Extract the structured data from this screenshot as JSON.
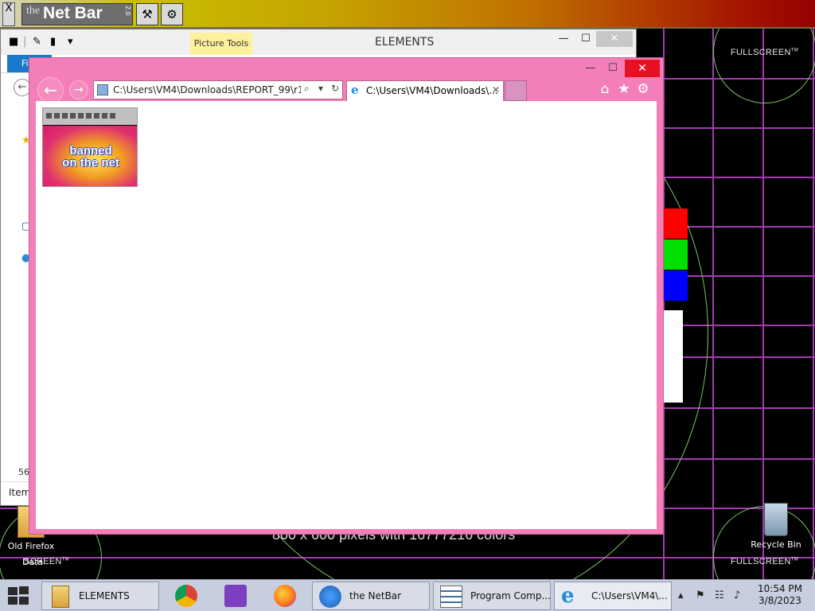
{
  "netbar": {
    "logo_prefix": "the",
    "logo_name": "Net Bar",
    "logo_version": "2.0",
    "close_glyph": "X",
    "buttons": [
      {
        "name": "connect-icon",
        "glyph": "⚒"
      },
      {
        "name": "tools-icon",
        "glyph": "⚙"
      }
    ]
  },
  "explorer": {
    "title": "ELEMENTS",
    "picture_tools": "Picture Tools",
    "file_tab": "Fi",
    "item_count": "56",
    "status_text": "Item",
    "minimize": "—",
    "maximize": "☐",
    "close": "✕"
  },
  "ie": {
    "address": "C:\\Users\\VM4\\Downloads\\REPORT_99\\r1997",
    "tab_title": "C:\\Users\\VM4\\Downloads\\...",
    "tab_close": "✕",
    "minimize": "—",
    "maximize": "☐",
    "close": "✕",
    "back_glyph": "←",
    "forward_glyph": "→",
    "search_glyph": "⌕",
    "dropdown_glyph": "▾",
    "refresh_glyph": "↻",
    "home_glyph": "⌂",
    "favorites_glyph": "★",
    "tools_glyph": "⚙",
    "image_text_line1": "banned",
    "image_text_line2": "on the net"
  },
  "desktop": {
    "fullscreen_labels": [
      "FULLSCREEN",
      "FULLSCREEN",
      "SCREEN"
    ],
    "tm": "TM",
    "resolution_text": "800 x 600 pixels with 16777216 colors",
    "icons": {
      "old_firefox": "Old Firefox",
      "idata": "Data",
      "recycle_bin": "Recycle Bin"
    },
    "swatch_colors": [
      "#ff0000",
      "#00e000",
      "#0000ff",
      "#ffffff"
    ]
  },
  "taskbar": {
    "buttons": [
      {
        "label": "ELEMENTS"
      },
      {
        "label": "the NetBar"
      },
      {
        "label": "Program Comp..."
      },
      {
        "label": "C:\\Users\\VM4\\..."
      }
    ],
    "tray": {
      "chevron": "▴",
      "flag": "⚑",
      "network": "☷",
      "volume": "♪"
    },
    "clock_time": "10:54 PM",
    "clock_date": "3/8/2023"
  }
}
